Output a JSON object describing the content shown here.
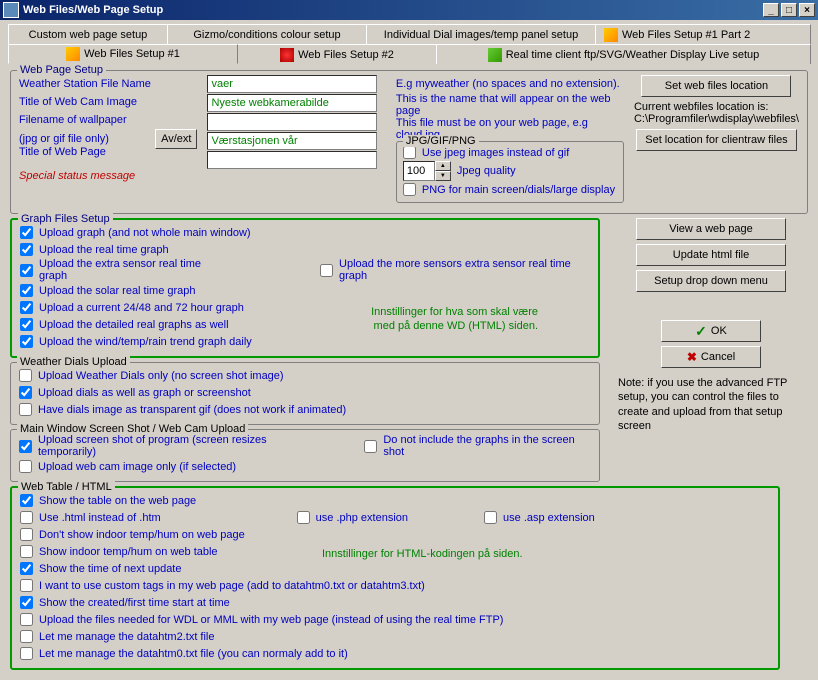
{
  "window": {
    "title": "Web Files/Web Page Setup"
  },
  "tabsRow1": [
    "Custom web page setup",
    "Gizmo/conditions colour setup",
    "Individual Dial images/temp panel setup",
    "Web Files Setup #1 Part 2"
  ],
  "tabsRow2": [
    "Web Files Setup #1",
    "Web Files Setup #2",
    "Real time client ftp/SVG/Weather Display Live setup"
  ],
  "setup": {
    "legend": "Web Page Setup",
    "wsFileNameLabel": "Weather Station File Name",
    "wsFileName": "vaer",
    "titleCamLabel": "Title of Web Cam Image",
    "titleCam": "Nyeste webkamerabilde",
    "wallpaperLabel": "Filename of wallpaper",
    "wallpaperSub": "(jpg or gif file only)",
    "avExtBtn": "Av/ext",
    "titlePageLabel": "Title of Web Page",
    "titlePage": "Værstasjonen vår",
    "specialStatus": "Special status message",
    "hint1": "E.g  myweather  (no spaces and no extension).",
    "hint2": "This is the name that will appear on the web page",
    "hint3": "This file must be on your web page, e.g cloud.jpg",
    "jpgLegend": "JPG/GIF/PNG",
    "useJpeg": "Use jpeg images instead of gif",
    "jpegQuality": "100",
    "jpegQualityLabel": "Jpeg quality",
    "pngMain": "PNG for main screen/dials/large display"
  },
  "rightButtons": {
    "setLoc": "Set web files location",
    "curLocLabel": "Current webfiles location is:",
    "curLoc": "C:\\Programfiler\\wdisplay\\webfiles\\",
    "setClientraw": "Set location for clientraw files",
    "viewPage": "View a web page",
    "updateHtml": "Update html file",
    "dropDown": "Setup drop down menu",
    "ok": "OK",
    "cancel": "Cancel",
    "note": "Note: if you use the advanced FTP setup, you can  control the files to create and upload from that setup screen"
  },
  "graphs": {
    "legend": "Graph Files Setup",
    "c1": "Upload graph (and not whole main window)",
    "c2": "Upload the real time graph",
    "c3": "Upload the extra sensor real time graph",
    "c3b": "Upload the more sensors extra sensor real time graph",
    "c4": "Upload the solar real time graph",
    "c5": "Upload a current 24/48 and 72 hour graph",
    "c6": "Upload the detailed real graphs as well",
    "c7": "Upload the wind/temp/rain trend graph daily",
    "note1": "Innstillinger for hva som skal være",
    "note2": "med på denne WD (HTML) siden."
  },
  "dials": {
    "legend": "Weather Dials Upload",
    "c1": "Upload Weather Dials only (no screen shot image)",
    "c2": "Upload dials as well as graph or screenshot",
    "c3": "Have dials image as transparent gif (does not work if animated)"
  },
  "mainwin": {
    "legend": "Main Window Screen Shot / Web Cam Upload",
    "c1": "Upload screen shot of program (screen resizes temporarily)",
    "c1b": "Do not include the graphs in  the screen shot",
    "c2": "Upload web cam image only (if selected)"
  },
  "webtable": {
    "legend": "Web Table / HTML",
    "c1": "Show the table on the web page",
    "c2": "Use .html instead of .htm",
    "c2b": "use .php extension",
    "c2c": "use .asp extension",
    "c3": "Don't show indoor temp/hum on web page",
    "c4": "Show indoor temp/hum on web table",
    "c5": "Show the time of next update",
    "c6": "I want to use custom tags in my web page (add to datahtm0.txt or datahtm3.txt)",
    "c7": "Show the created/first time start at time",
    "c8": "Upload the files needed for WDL or MML with my web page (instead of using the real time FTP)",
    "c9": "Let me manage the datahtm2.txt file",
    "c10": "Let me manage the datahtm0.txt file (you can normaly add to it)",
    "note": "Innstillinger for HTML-kodingen på siden."
  }
}
